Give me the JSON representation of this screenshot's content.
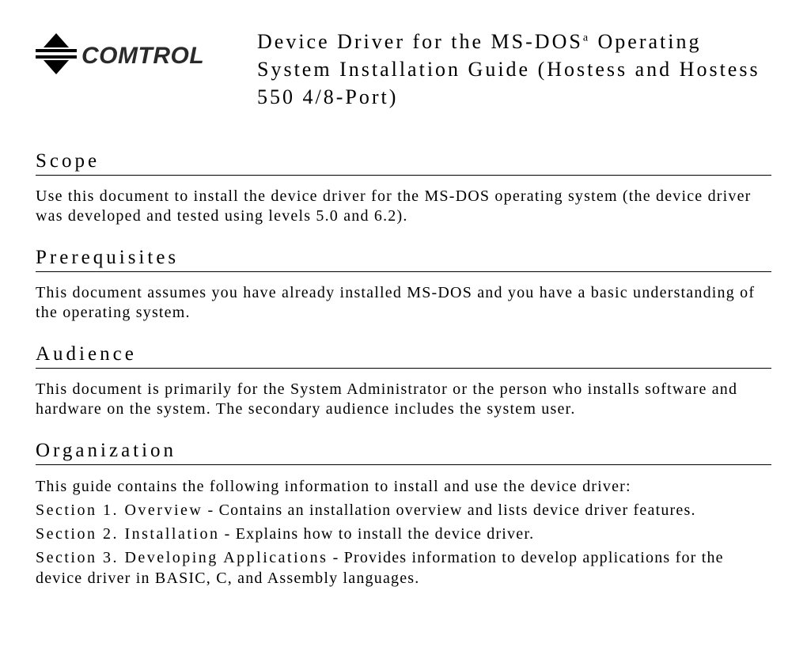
{
  "brand": "COMTROL",
  "title_prefix": "Device Driver for the MS-DOS",
  "title_sup": "a",
  "title_suffix": " Operating System Installation Guide (Hostess and Hostess 550 4/8-Port)",
  "sections": {
    "scope": {
      "heading": "Scope",
      "body": "Use this document to install the device driver for the MS-DOS operating system (the device driver was developed and tested using levels 5.0 and 6.2)."
    },
    "prereq": {
      "heading": "Prerequisites",
      "body": "This document assumes you have already installed MS-DOS and you have a basic understanding of the operating system."
    },
    "audience": {
      "heading": "Audience",
      "body": "This document is primarily for the System Administrator or the person who installs software and hardware on the system. The secondary audience includes the system user."
    },
    "organization": {
      "heading": "Organization",
      "intro": "This guide contains the following information to install and use the device driver:",
      "items": [
        {
          "label": "Section 1. Overview",
          "desc": " - Contains an installation overview and lists device driver features."
        },
        {
          "label": "Section 2. Installation",
          "desc": " - Explains how to install the device driver."
        },
        {
          "label": "Section 3. Developing Applications",
          "desc": " - Provides information to develop applications for the device driver in BASIC, C, and Assembly languages."
        }
      ]
    }
  }
}
